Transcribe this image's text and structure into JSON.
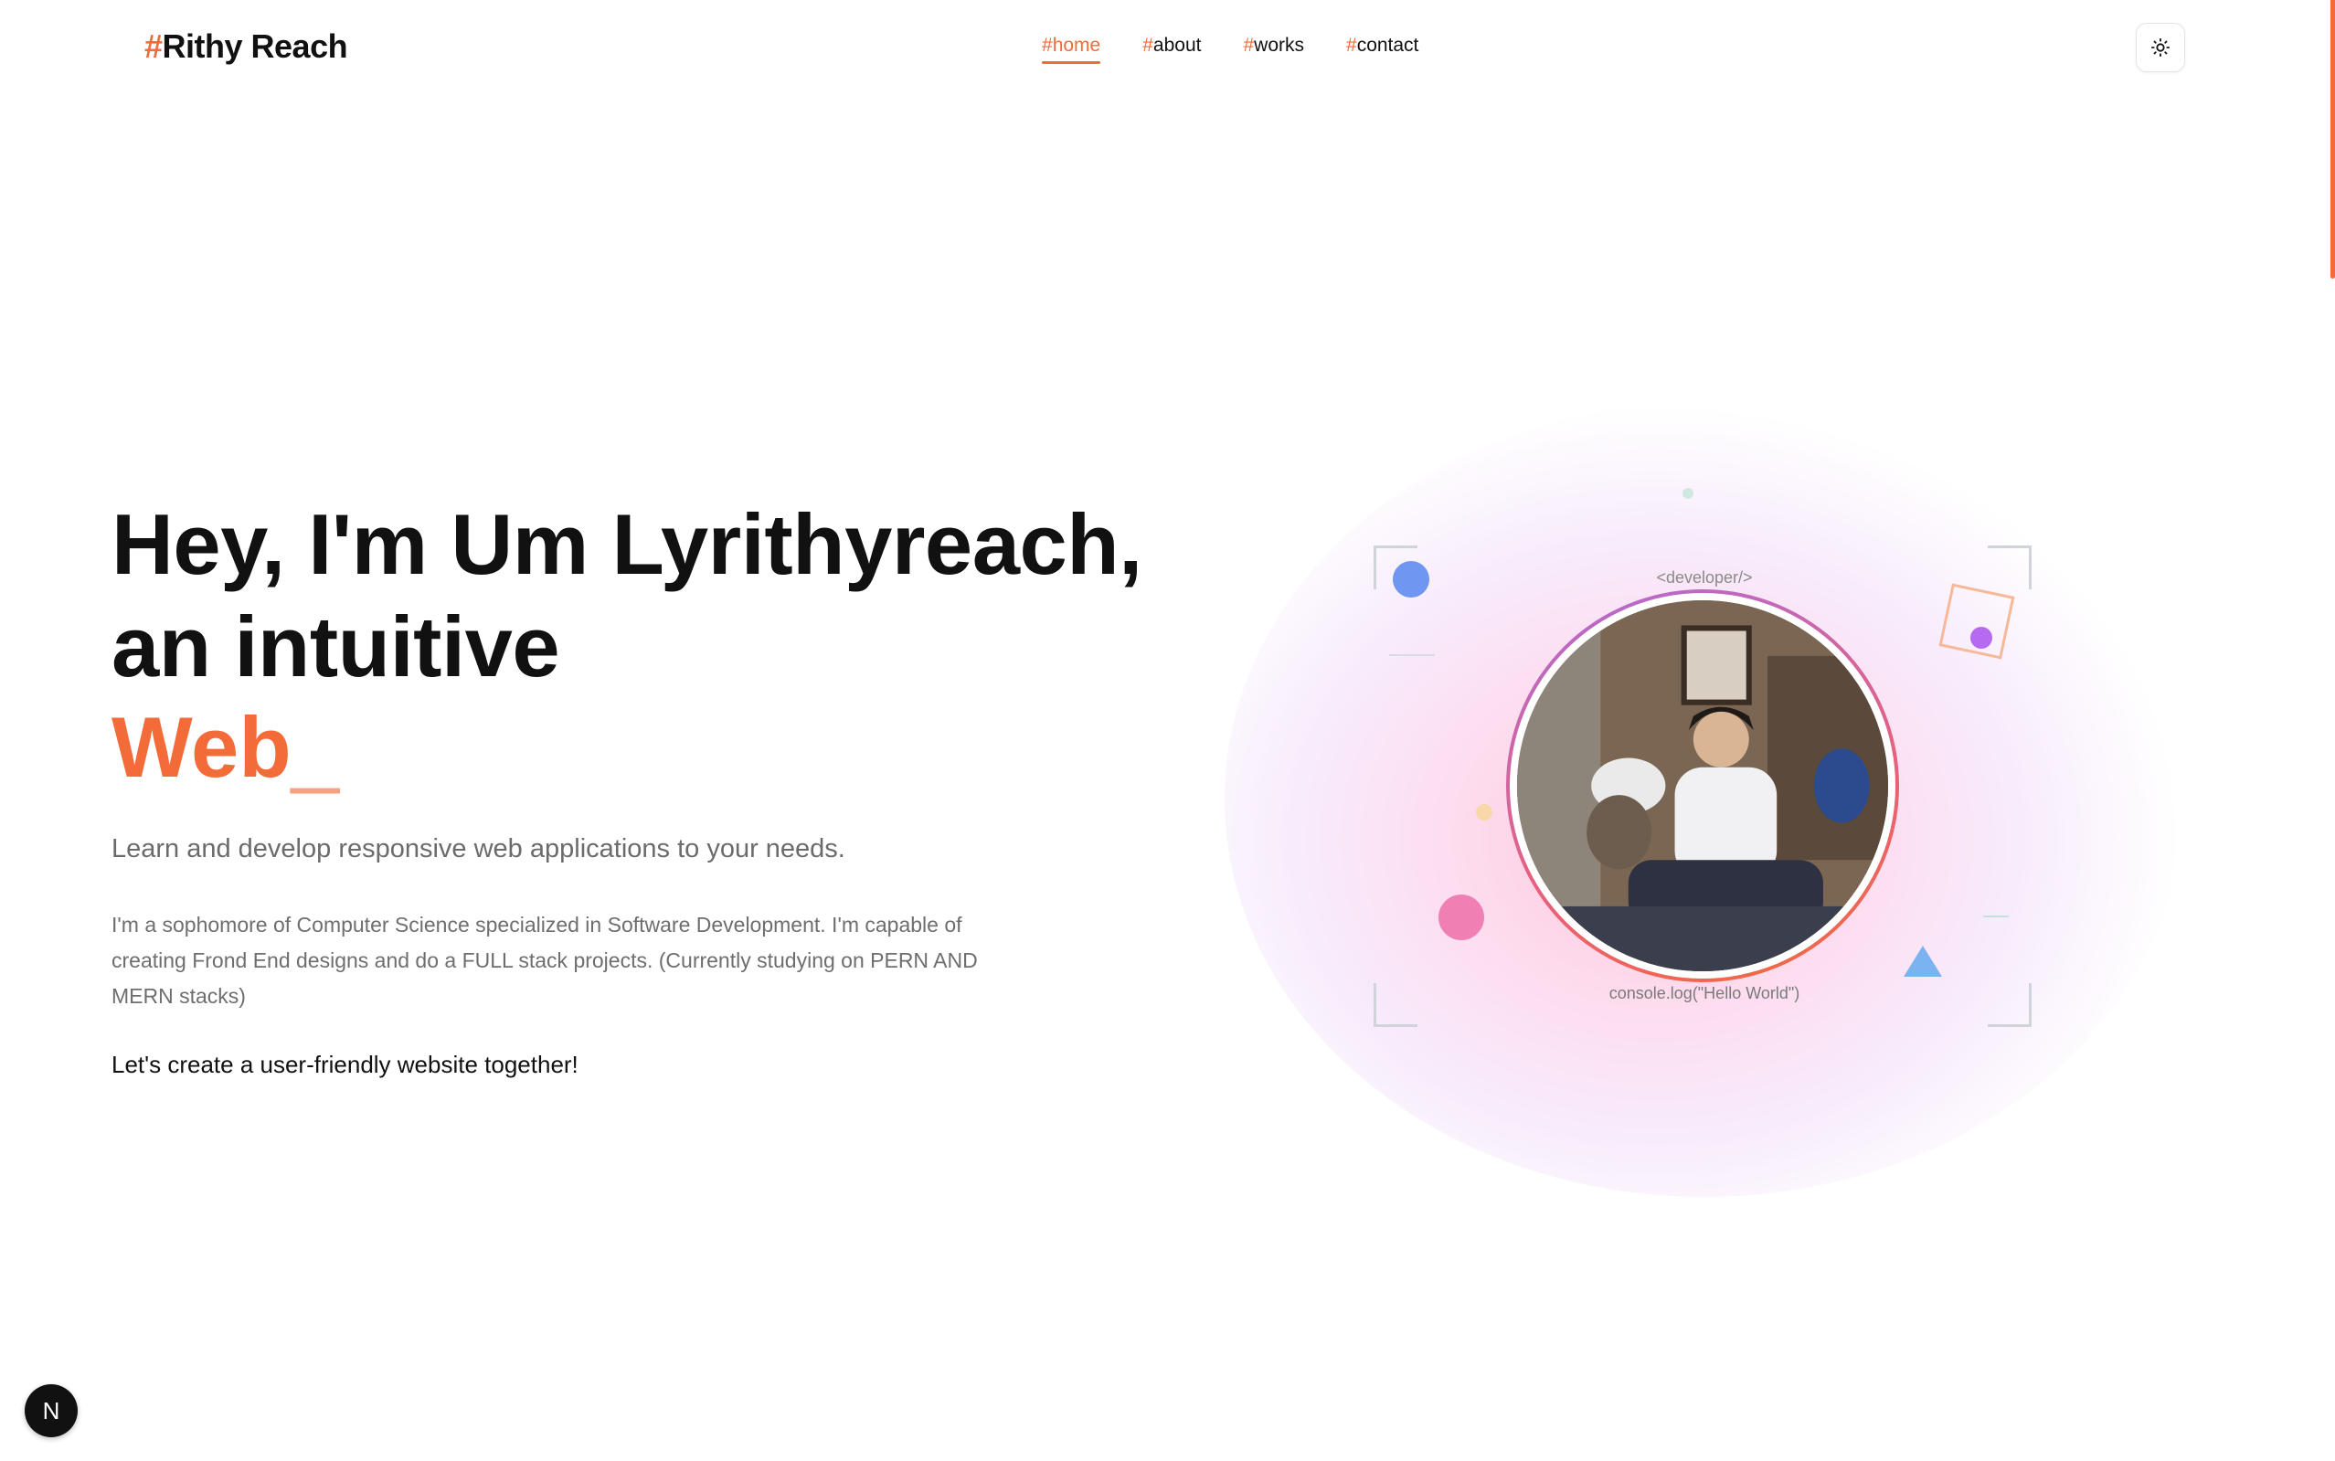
{
  "header": {
    "brand_hash": "#",
    "brand_name": "Rithy Reach",
    "nav": [
      {
        "hash": "#",
        "label": "home",
        "active": true
      },
      {
        "hash": "#",
        "label": "about",
        "active": false
      },
      {
        "hash": "#",
        "label": "works",
        "active": false
      },
      {
        "hash": "#",
        "label": "contact",
        "active": false
      }
    ],
    "theme_toggle_icon": "sun-icon"
  },
  "hero": {
    "headline_line1": "Hey, I'm Um Lyrithyreach,",
    "headline_line2": "an intuitive",
    "typed_word": "Web",
    "typed_cursor": "_",
    "subtitle": "Learn and develop responsive web applications to your needs.",
    "bio": "I'm a sophomore of Computer Science specialized in Software Development. I'm capable of creating Frond End designs and do a FULL stack projects. (Currently studying on PERN AND MERN stacks)",
    "cta": "Let's create a user-friendly website together!"
  },
  "visual": {
    "top_tag": "<developer/>",
    "bottom_tag": "console.log(\"Hello World\")"
  },
  "colors": {
    "accent": "#f26b38",
    "text": "#111111",
    "muted": "#6b6b6b"
  },
  "badge": {
    "label": "N"
  }
}
